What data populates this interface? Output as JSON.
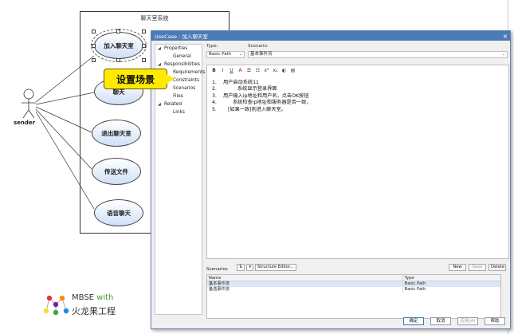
{
  "diagram": {
    "system_title": "聊天室系统",
    "actor_label": "sender",
    "use_cases": [
      "加入聊天室",
      "聊天",
      "退出聊天室",
      "传送文件",
      "语音聊天"
    ]
  },
  "callout": {
    "text": "设置场景"
  },
  "logo": {
    "line1_prefix": "MBSE",
    "line1_with": "with",
    "line2": "火龙果工程"
  },
  "dialog": {
    "title": "UseCase : 加入聊天室",
    "nav": [
      {
        "label": "Properties",
        "level": 0,
        "expanded": true
      },
      {
        "label": "General",
        "level": 1
      },
      {
        "label": "Responsibilities",
        "level": 0,
        "expanded": true
      },
      {
        "label": "Requirements",
        "level": 1
      },
      {
        "label": "Constraints",
        "level": 1
      },
      {
        "label": "Scenarios",
        "level": 1
      },
      {
        "label": "Files",
        "level": 1
      },
      {
        "label": "Related",
        "level": 0,
        "expanded": true
      },
      {
        "label": "Links",
        "level": 1
      }
    ],
    "type_label": "Type:",
    "type_value": "Basic Path",
    "scenario_label": "Scenario:",
    "scenario_value": "基本事件流",
    "steps": [
      {
        "num": "1.",
        "text": "用户启动系统11"
      },
      {
        "num": "2.",
        "text": "系统显示登录界面"
      },
      {
        "num": "3.",
        "text": "用户输入ip地址和用户名，点击OK按钮"
      },
      {
        "num": "4.",
        "text": "系统检查ip地址和服务器是否一致，"
      },
      {
        "num": "5.",
        "text": "[如果一致]则进入聊天室。"
      }
    ],
    "scenarios_label": "Scenarios",
    "structure_editor_label": "Structure Editor...",
    "new_label": "New",
    "save_label": "Save",
    "delete_label": "Delete",
    "col_name": "Name",
    "col_type": "Type",
    "rows": [
      {
        "name": "基本事件流",
        "type": "Basic Path"
      },
      {
        "name": "备选事件流",
        "type": "Basic Path"
      }
    ],
    "ok_label": "确定",
    "cancel_label": "取消",
    "apply_label": "应用(A)",
    "help_label": "帮助"
  }
}
